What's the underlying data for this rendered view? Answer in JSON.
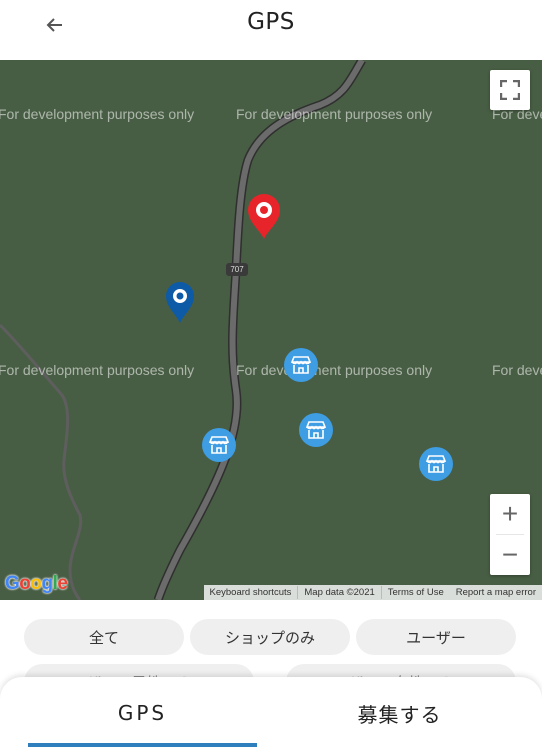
{
  "header": {
    "title": "GPS",
    "back_icon": "arrow-left-icon"
  },
  "map": {
    "watermark_text": "For development purposes only",
    "route_number": "707",
    "google_logo": "Google",
    "attribution": {
      "keyboard_shortcuts": "Keyboard shortcuts",
      "map_data": "Map data ©2021",
      "terms": "Terms of Use",
      "report": "Report a map error"
    },
    "zoom_in_label": "+",
    "zoom_out_label": "−",
    "colors": {
      "background": "#485e44",
      "road": "#6b6b6b",
      "current_location_pin": "#e8242b",
      "user_pin": "#0d5aa7",
      "shop_marker": "#3e9de3"
    }
  },
  "filters": {
    "all": "全て",
    "shops_only": "ショップのみ",
    "users": "ユーザー",
    "partial_left": "ザー　男性のみ",
    "partial_right": "ザー　女性のみ"
  },
  "bottom_nav": {
    "tabs": [
      {
        "label": "GPS",
        "active": true
      },
      {
        "label": "募集する",
        "active": false
      }
    ],
    "accent": "#2f7fbf"
  }
}
